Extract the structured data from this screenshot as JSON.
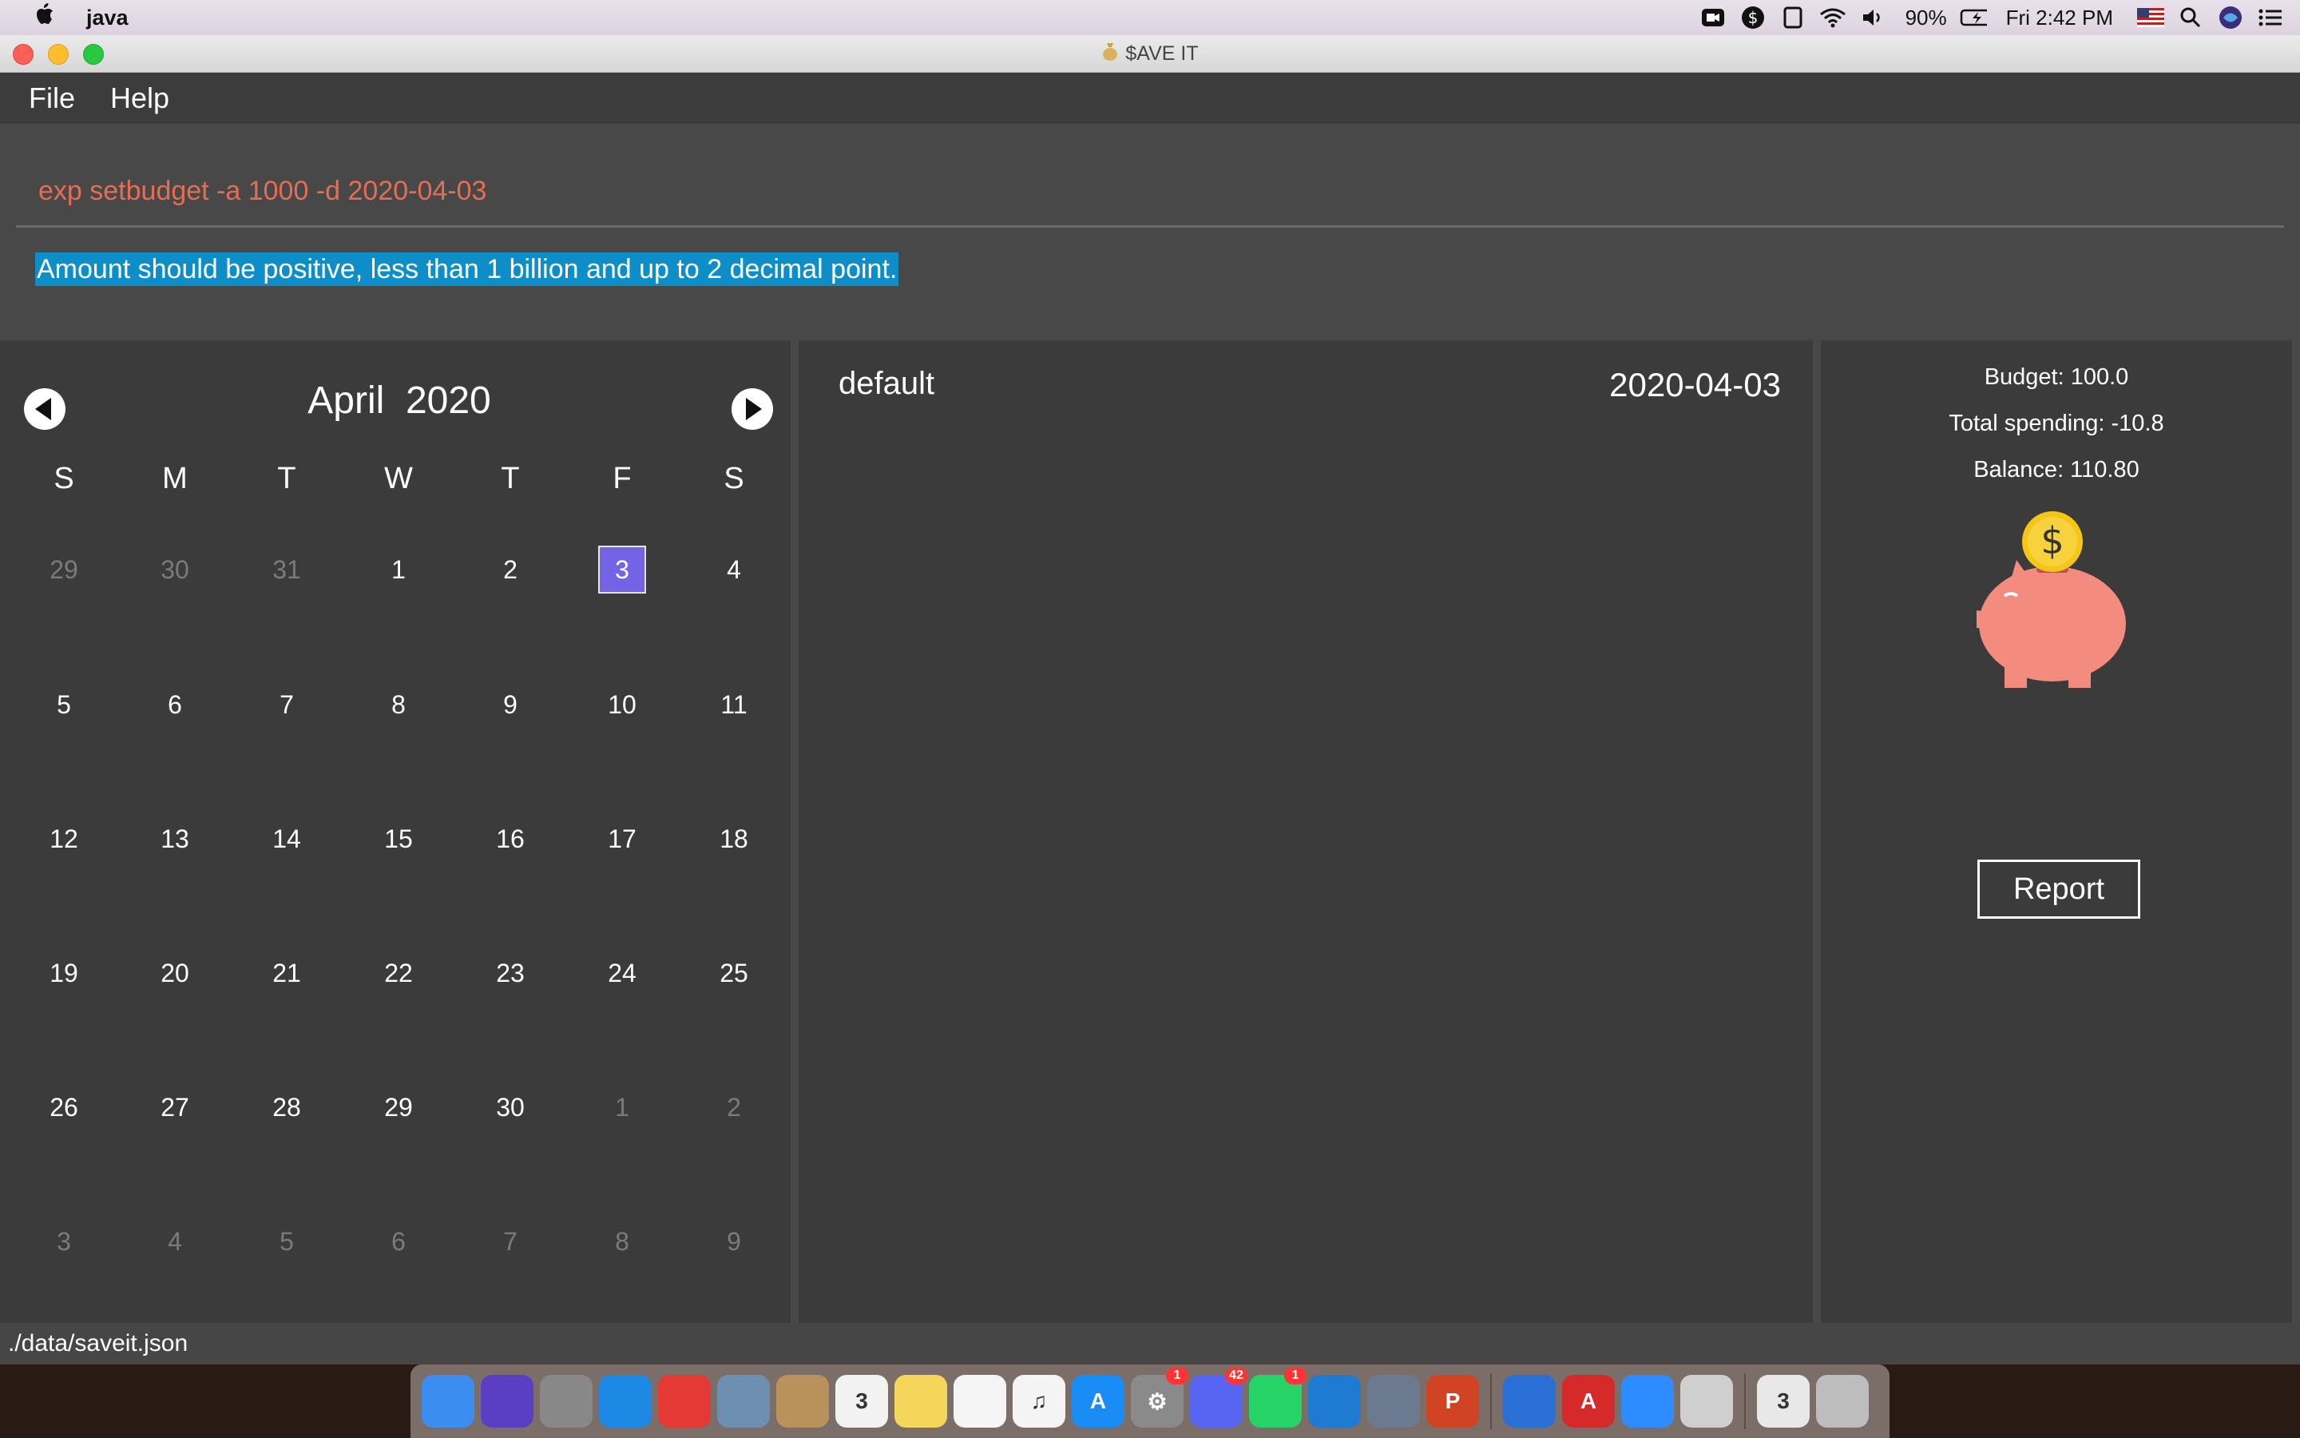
{
  "menubar": {
    "app_name": "java",
    "battery": "90%",
    "clock": "Fri 2:42 PM"
  },
  "window": {
    "title": "$AVE IT"
  },
  "menu": {
    "file": "File",
    "help": "Help"
  },
  "command": {
    "text": "exp setbudget -a 1000 -d 2020-04-03"
  },
  "result": {
    "text": "Amount should be positive, less than 1 billion and up to 2 decimal point."
  },
  "calendar": {
    "month": "April",
    "year": "2020",
    "weekdays": [
      "S",
      "M",
      "T",
      "W",
      "T",
      "F",
      "S"
    ],
    "weeks": [
      [
        "29",
        "30",
        "31",
        "1",
        "2",
        "3",
        "4"
      ],
      [
        "5",
        "6",
        "7",
        "8",
        "9",
        "10",
        "11"
      ],
      [
        "12",
        "13",
        "14",
        "15",
        "16",
        "17",
        "18"
      ],
      [
        "19",
        "20",
        "21",
        "22",
        "23",
        "24",
        "25"
      ],
      [
        "26",
        "27",
        "28",
        "29",
        "30",
        "1",
        "2"
      ],
      [
        "3",
        "4",
        "5",
        "6",
        "7",
        "8",
        "9"
      ]
    ],
    "selected_day": "3",
    "selected_color": "#7563e6"
  },
  "list": {
    "name": "default",
    "date": "2020-04-03"
  },
  "summary": {
    "budget": "Budget: 100.0",
    "total_spending": "Total spending: -10.8",
    "balance": "Balance: 110.80",
    "coin_symbol": "$",
    "report_label": "Report"
  },
  "status": {
    "path": "./data/saveit.json"
  },
  "dock": {
    "items": [
      {
        "name": "finder",
        "color": "#3b8ef0",
        "glyph": ""
      },
      {
        "name": "siri",
        "color": "#5a3fc4",
        "glyph": ""
      },
      {
        "name": "launchpad",
        "color": "#888",
        "glyph": ""
      },
      {
        "name": "safari",
        "color": "#1e88e5",
        "glyph": ""
      },
      {
        "name": "chrome",
        "color": "#e53935",
        "glyph": ""
      },
      {
        "name": "preview",
        "color": "#6d8fb0",
        "glyph": ""
      },
      {
        "name": "contacts",
        "color": "#b8925a",
        "glyph": ""
      },
      {
        "name": "calendar",
        "color": "#f2f2f2",
        "glyph": "3"
      },
      {
        "name": "notes",
        "color": "#f6d65a",
        "glyph": ""
      },
      {
        "name": "reminders",
        "color": "#f5f5f5",
        "glyph": ""
      },
      {
        "name": "music",
        "color": "#f4f4f4",
        "glyph": "♫"
      },
      {
        "name": "app-store",
        "color": "#1a8cf5",
        "glyph": "A"
      },
      {
        "name": "system-preferences",
        "color": "#8a8a8a",
        "glyph": "⚙",
        "badge": "1"
      },
      {
        "name": "discord",
        "color": "#5865f2",
        "glyph": "",
        "badge": "42"
      },
      {
        "name": "whatsapp",
        "color": "#25d366",
        "glyph": "",
        "badge": "1"
      },
      {
        "name": "vscode",
        "color": "#1f7ad1",
        "glyph": ""
      },
      {
        "name": "virtualbox",
        "color": "#6b7a8f",
        "glyph": ""
      },
      {
        "name": "powerpoint",
        "color": "#d04423",
        "glyph": "P"
      },
      {
        "name": "sourcetree",
        "color": "#2a6fd6",
        "glyph": ""
      },
      {
        "name": "angular",
        "color": "#d62a2a",
        "glyph": "A"
      },
      {
        "name": "zoom",
        "color": "#2d8cff",
        "glyph": ""
      },
      {
        "name": "java-app",
        "color": "#cfcfcf",
        "glyph": ""
      },
      {
        "name": "downloads-calendar",
        "color": "#e8e8e8",
        "glyph": "3"
      },
      {
        "name": "trash",
        "color": "#bdbdbd",
        "glyph": ""
      }
    ]
  }
}
